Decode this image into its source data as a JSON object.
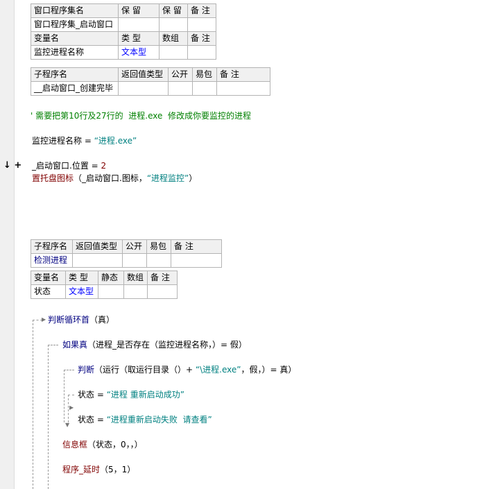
{
  "module_table": {
    "headers": [
      "窗口程序集名",
      "保 留",
      "保 留",
      "备 注"
    ],
    "row": [
      "窗口程序集_启动窗口",
      "",
      "",
      ""
    ],
    "var_headers": [
      "变量名",
      "类 型",
      "数组",
      "备 注"
    ],
    "var_row": [
      "监控进程名称",
      "文本型",
      "",
      ""
    ]
  },
  "sub1_table": {
    "headers": [
      "子程序名",
      "返回值类型",
      "公开",
      "易包",
      "备 注"
    ],
    "row": [
      "__启动窗口_创建完毕",
      "",
      "",
      "",
      ""
    ]
  },
  "code1": {
    "comment": "' 需要把第10行及27行的  进程.exe  修改成你要监控的进程",
    "assign_var": "监控进程名称",
    "assign_op": " = ",
    "assign_val": "“进程.exe”",
    "gutter_marker": "↓ +",
    "pos_line_a": "_启动窗口.位置",
    "pos_line_op": " = ",
    "pos_line_val": "2",
    "tray_fn": "置托盘图标",
    "tray_args_a": "（_启动窗口.图标，",
    "tray_args_str": "“进程监控”",
    "tray_args_end": "）"
  },
  "sub2_table": {
    "headers": [
      "子程序名",
      "返回值类型",
      "公开",
      "易包",
      "备 注"
    ],
    "row": [
      "检测进程",
      "",
      "",
      "",
      ""
    ],
    "var_headers": [
      "变量名",
      "类 型",
      "静态",
      "数组",
      "备 注"
    ],
    "var_row": [
      "状态",
      "文本型",
      "",
      "",
      ""
    ]
  },
  "code2": {
    "loop_kw": "判断循环首",
    "loop_args": "（真）",
    "if_kw": "如果真",
    "if_args": "（进程_是否存在（监控进程名称，）= 假）",
    "judge_kw": "判断",
    "judge_args_a": "（运行（取运行目录（）+ ",
    "judge_args_str": "“\\进程.exe”",
    "judge_args_b": "，假，）= 真）",
    "status_var": "状态",
    "status_op": " = ",
    "status_ok": "“进程 重新启动成功”",
    "status_fail": "“进程重新启动失败  请查看”",
    "msgbox_fn": "信息框",
    "msgbox_args": "（状态，0，，）",
    "delay_fn": "程序_延时",
    "delay_args": "（5，1）"
  }
}
